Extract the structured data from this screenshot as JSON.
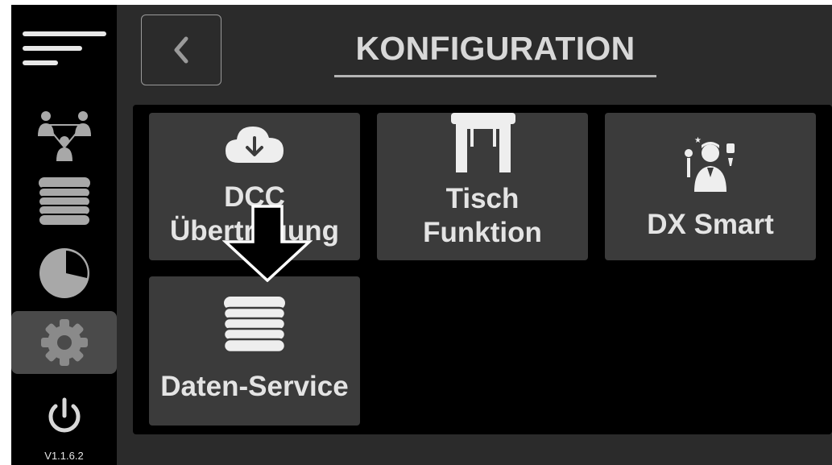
{
  "header": {
    "title": "KONFIGURATION"
  },
  "sidebar": {
    "items": [
      {
        "name": "menu-icon",
        "active": false
      },
      {
        "name": "users-network-icon",
        "active": false
      },
      {
        "name": "database-icon",
        "active": false
      },
      {
        "name": "pie-chart-icon",
        "active": false
      },
      {
        "name": "gear-icon",
        "active": true
      },
      {
        "name": "power-icon",
        "active": false
      }
    ],
    "version": "V1.1.6.2"
  },
  "tiles": [
    {
      "line1": "DCC",
      "line2": "Übertragung",
      "icon": "cloud-download-icon"
    },
    {
      "line1": "Tisch",
      "line2": "Funktion",
      "icon": "table-icon"
    },
    {
      "line1": "DX Smart",
      "icon": "waiter-icon"
    },
    {
      "line1": "Daten-Service",
      "icon": "database-icon"
    }
  ],
  "overlay": {
    "icon": "down-arrow-icon"
  },
  "colors": {
    "background": "#000000",
    "main": "#2b2b2b",
    "tile": "#3b3b3b",
    "text": "#e4e4e4",
    "active_sidebar": "#4a4a4a"
  }
}
